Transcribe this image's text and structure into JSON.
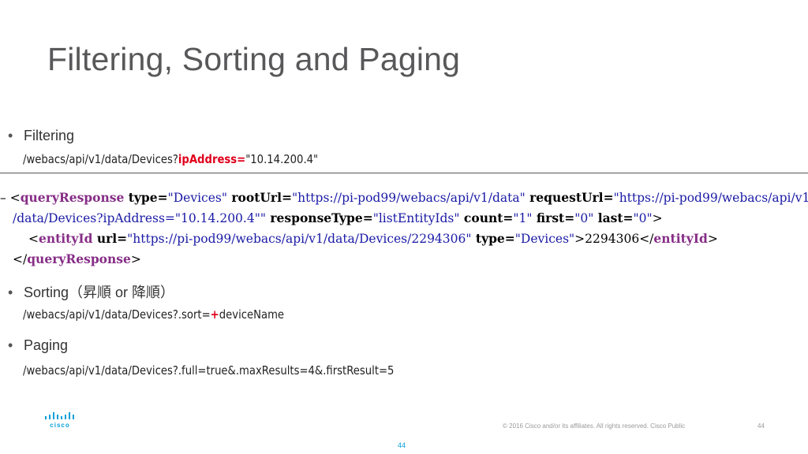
{
  "title": "Filtering, Sorting and Paging",
  "bullets": {
    "filtering": {
      "label": "Filtering",
      "url_prefix": "/webacs/api/v1/data/Devices?",
      "url_highlight": "ipAddress=",
      "url_suffix": "\"10.14.200.4\""
    },
    "sorting": {
      "label": "Sorting（昇順 or 降順）",
      "url_prefix": "/webacs/api/v1/data/Devices?.sort=",
      "url_highlight": "+",
      "url_suffix": "deviceName"
    },
    "paging": {
      "label": "Paging",
      "url": "/webacs/api/v1/data/Devices?.full=true&.maxResults=4&.firstResult=5"
    }
  },
  "xml": {
    "dash": "– ",
    "lt": "<",
    "gt": ">",
    "close_lt": "</",
    "root_tag": "queryResponse",
    "attr_type": " type=",
    "val_type": "\"Devices\"",
    "attr_rootUrl": " rootUrl=",
    "val_rootUrl": "\"https://pi-pod99/webacs/api/v1/data\"",
    "attr_requestUrl": " requestUrl=",
    "val_requestUrl_1": "\"https://pi-pod99/webacs/api/v1",
    "val_requestUrl_2": "/data/Devices?ipAddress=\"10.14.200.4\"\"",
    "attr_responseType": " responseType=",
    "val_responseType": "\"listEntityIds\"",
    "attr_count": " count=",
    "val_count": "\"1\"",
    "attr_first": " first=",
    "val_first": "\"0\"",
    "attr_last": " last=",
    "val_last": "\"0\"",
    "entity_tag": "entityId",
    "attr_url": " url=",
    "val_url": "\"https://pi-pod99/webacs/api/v1/data/Devices/2294306\"",
    "val_entity_type": "\"Devices\"",
    "entity_value": "2294306"
  },
  "footer": {
    "copyright": "© 2016  Cisco and/or its affiliates. All rights reserved.   Cisco Public",
    "page_number": "44",
    "center_page": "44",
    "logo_text": "cisco"
  },
  "colors": {
    "accent_red": "#e0001b",
    "cisco_blue": "#049fd9",
    "title_gray": "#58585a"
  }
}
